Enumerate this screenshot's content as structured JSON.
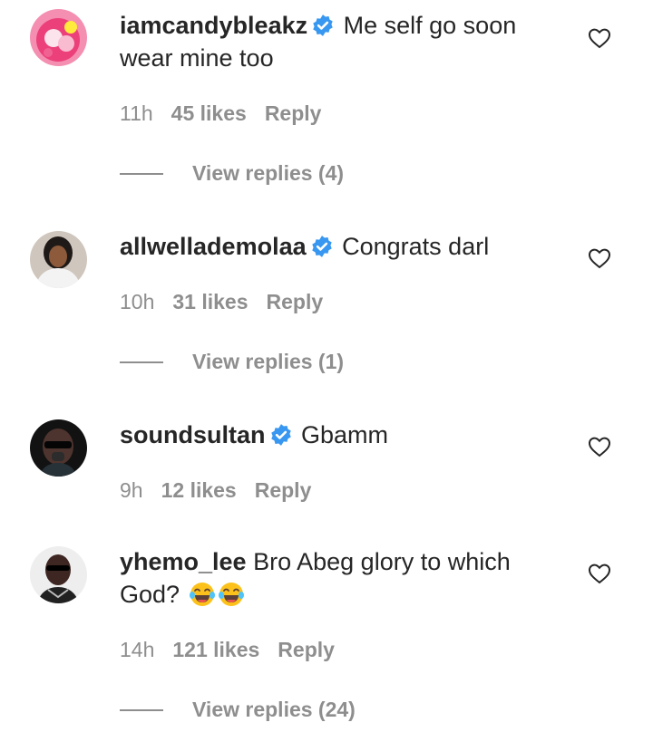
{
  "colors": {
    "text": "#262626",
    "secondary": "#8e8e8e",
    "verified": "#3897f0",
    "background": "#ffffff"
  },
  "comments": [
    {
      "username": "iamcandybleakz",
      "verified": true,
      "text": "Me self go soon wear mine too",
      "emoji": "",
      "time": "11h",
      "likes": "45 likes",
      "reply": "Reply",
      "view_replies": "View replies (4)",
      "avatar_icon": "pink-avatar-icon"
    },
    {
      "username": "allwellademolaa",
      "verified": true,
      "text": "Congrats darl",
      "emoji": "",
      "time": "10h",
      "likes": "31 likes",
      "reply": "Reply",
      "view_replies": "View replies (1)",
      "avatar_icon": "user-photo-icon"
    },
    {
      "username": "soundsultan",
      "verified": true,
      "text": "Gbamm",
      "emoji": "",
      "time": "9h",
      "likes": "12 likes",
      "reply": "Reply",
      "view_replies": "",
      "avatar_icon": "user-photo-icon"
    },
    {
      "username": "yhemo_lee",
      "verified": false,
      "text": "Bro Abeg glory to which God?",
      "emoji": "😂😂",
      "time": "14h",
      "likes": "121 likes",
      "reply": "Reply",
      "view_replies": "View replies (24)",
      "avatar_icon": "user-photo-icon"
    }
  ]
}
